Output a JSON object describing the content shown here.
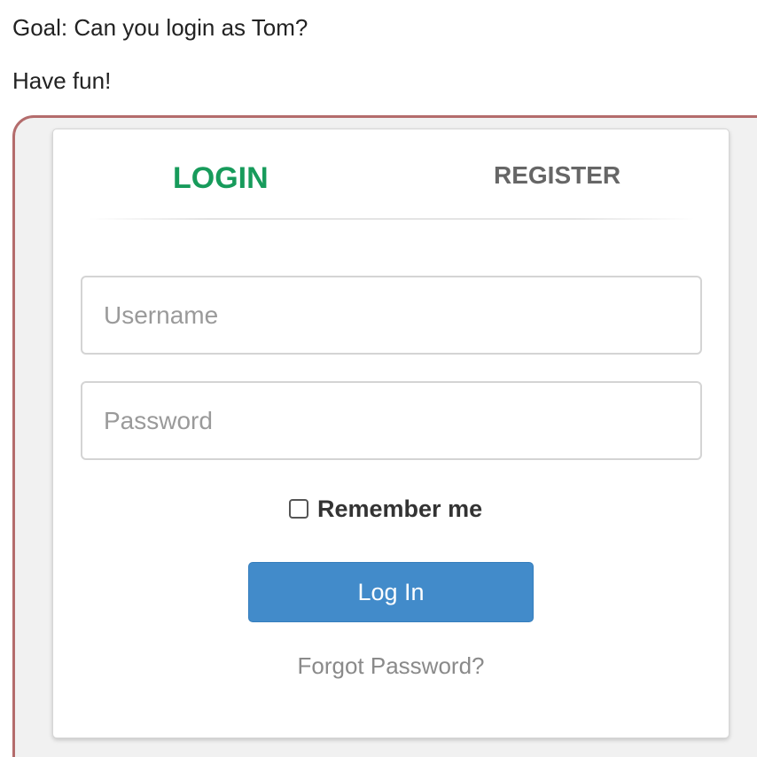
{
  "intro": {
    "goal": "Goal: Can you login as Tom?",
    "fun": "Have fun!"
  },
  "tabs": {
    "login": "LOGIN",
    "register": "REGISTER"
  },
  "form": {
    "username_placeholder": "Username",
    "password_placeholder": "Password",
    "remember_label": "Remember me",
    "login_button": "Log In",
    "forgot_link": "Forgot Password?"
  },
  "colors": {
    "active_tab": "#179b5b",
    "button": "#428bca",
    "frame_border": "#b46c6c"
  }
}
